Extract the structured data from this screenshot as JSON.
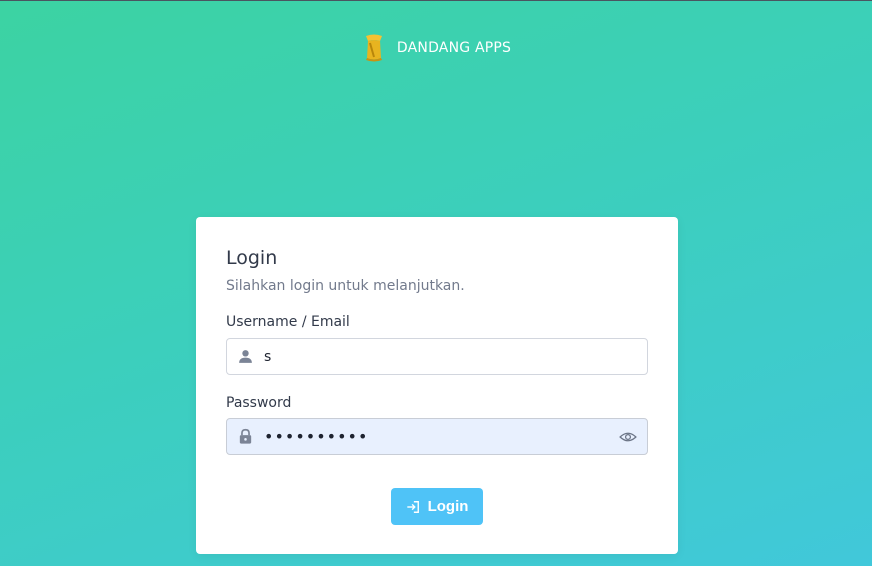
{
  "brand": {
    "name": "DANDANG APPS",
    "logo_icon": "gold-brush-logo-icon"
  },
  "login_card": {
    "title": "Login",
    "subtitle": "Silahkan login untuk melanjutkan.",
    "username": {
      "label": "Username / Email",
      "value": "s",
      "icon": "user-icon"
    },
    "password": {
      "label": "Password",
      "value": "1234567890",
      "icon": "lock-icon",
      "toggle_icon": "eye-icon"
    },
    "submit": {
      "label": "Login",
      "icon": "login-arrow-icon"
    }
  },
  "colors": {
    "background_start": "#3cd3a2",
    "background_end": "#41c8da",
    "button": "#4fc3f7",
    "text_dark": "#323a4a",
    "text_muted": "#727a8c",
    "autofill_bg": "#e8f0fe",
    "logo_gold": "#e8b420"
  }
}
